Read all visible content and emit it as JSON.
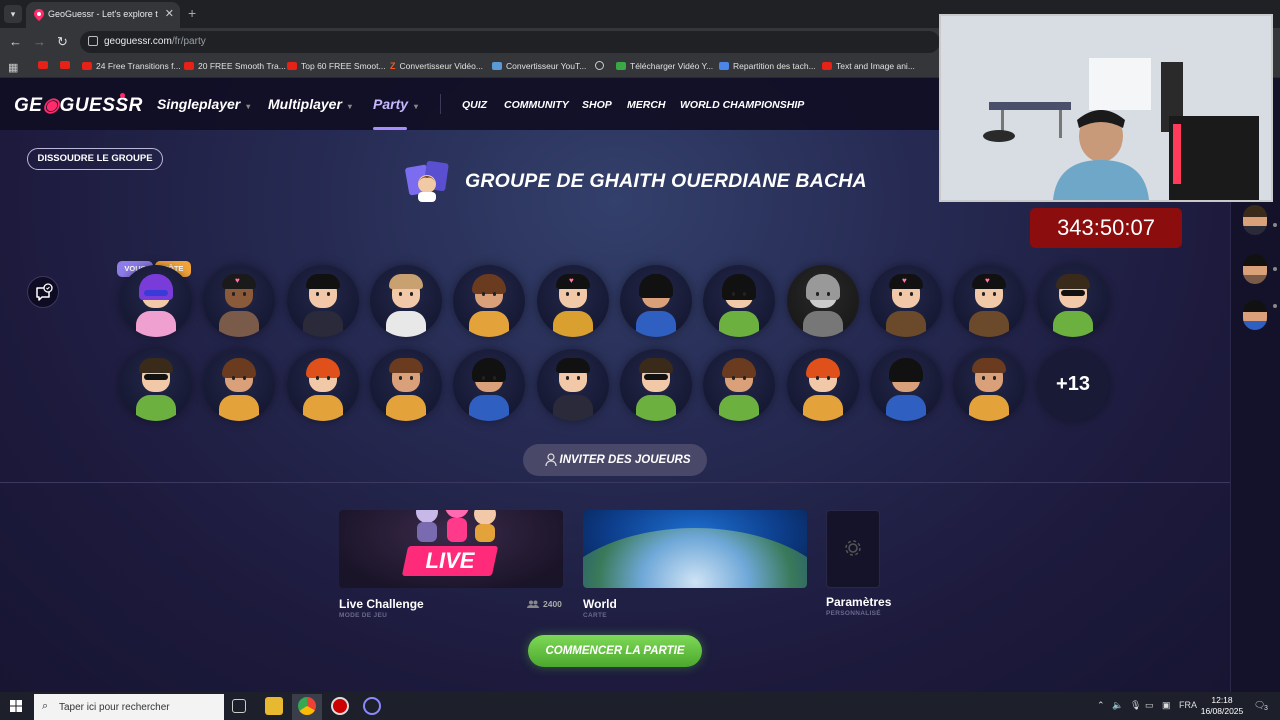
{
  "browser": {
    "tab_title": "GeoGuessr - Let's explore the w",
    "url_host": "geoguessr.com",
    "url_path": "/fr/party",
    "bookmarks": [
      {
        "label": "",
        "icon": "youtube-icon"
      },
      {
        "label": "",
        "icon": "youtube-icon"
      },
      {
        "label": "24 Free Transitions f...",
        "icon": "youtube-icon"
      },
      {
        "label": "20 FREE Smooth Tra...",
        "icon": "youtube-icon"
      },
      {
        "label": "Top 60 FREE Smoot...",
        "icon": "youtube-icon"
      },
      {
        "label": "Convertisseur Vidéo...",
        "icon": "z-icon"
      },
      {
        "label": "Convertisseur YouT...",
        "icon": "converter-icon"
      },
      {
        "label": "",
        "icon": "globe-icon"
      },
      {
        "label": "Télécharger Vidéo Y...",
        "icon": "download-icon"
      },
      {
        "label": "Repartition des tach...",
        "icon": "doc-icon"
      },
      {
        "label": "Text and Image ani...",
        "icon": "youtube-icon"
      }
    ]
  },
  "site": {
    "logo": "GEOGUESSR",
    "nav": [
      {
        "label": "Singleplayer",
        "active": false
      },
      {
        "label": "Multiplayer",
        "active": false
      },
      {
        "label": "Party",
        "active": true
      }
    ],
    "subnav": [
      "QUIZ",
      "COMMUNITY",
      "SHOP",
      "MERCH",
      "WORLD CHAMPIONSHIP"
    ],
    "dissolve_label": "DISSOUDRE LE GROUPE",
    "group_title": "GROUPE DE GHAITH OUERDIANE BACHA",
    "badges": {
      "you": "VOUS",
      "host": "HÔTE"
    },
    "more_players": "+13",
    "invite_label": "INVITER DES JOUEURS",
    "cards": {
      "live": {
        "title": "Live Challenge",
        "subtitle": "MODE DE JEU",
        "tag": "LIVE",
        "count": "2400"
      },
      "world": {
        "title": "World",
        "subtitle": "CARTE"
      },
      "settings": {
        "title": "Paramètres",
        "subtitle": "PERSONNALISÉ"
      }
    },
    "start_label": "COMMENCER LA PARTIE"
  },
  "overlay": {
    "timer": "343:50:07"
  },
  "taskbar": {
    "search_placeholder": "Taper ici pour rechercher",
    "language": "FRA",
    "time": "12:18",
    "date": "16/08/2025",
    "notification_count": "3"
  },
  "colors": {
    "accent_pink": "#ff2b6a",
    "party_active": "#c7b8ff",
    "start_green": "#5cbf3a",
    "timer_red": "#8b0d0d",
    "badge_you": "#8e7de8",
    "badge_host": "#f2a33a"
  }
}
